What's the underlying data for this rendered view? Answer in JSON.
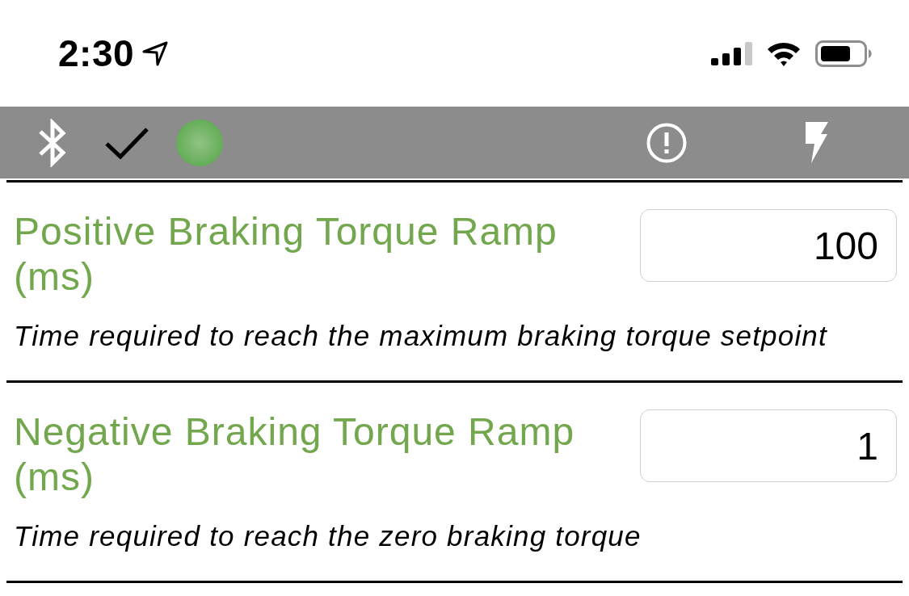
{
  "status_bar": {
    "time": "2:30"
  },
  "settings": [
    {
      "title": "Positive Braking Torque Ramp (ms)",
      "value": "100",
      "description": "Time required to reach the maximum braking torque setpoint"
    },
    {
      "title": "Negative Braking Torque Ramp (ms)",
      "value": "1",
      "description": "Time required to reach the zero braking torque"
    }
  ]
}
